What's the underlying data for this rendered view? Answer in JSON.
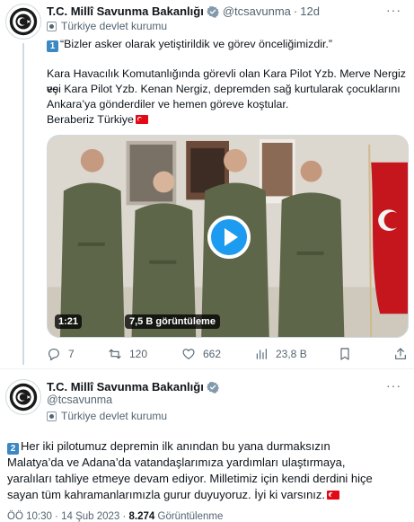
{
  "tweet1": {
    "name": "T.C. Millî Savunma Bakanlığı",
    "handle": "@tcsavunma",
    "time": "12d",
    "org": "Türkiye devlet kurumu",
    "line1": "“Bizler asker olarak yetiştirildik ve görev önceliğimizdir.”",
    "line2": "Kara Havacılık Komutanlığında görevli olan Kara Pilot Yzb. Merve Nergiz ve",
    "line3": "eşi Kara Pilot Yzb. Kenan Nergiz, depremden sağ kurtularak çocuklarını",
    "line4": "Ankara’ya gönderdiler ve hemen göreve koştular.",
    "line5": "Beraberiz Türkiye",
    "number_emoji": "1",
    "video": {
      "duration": "1:21",
      "views": "7,5 B görüntüleme"
    },
    "actions": {
      "replies": "7",
      "retweets": "120",
      "likes": "662",
      "views": "23,8 B"
    }
  },
  "tweet2": {
    "name": "T.C. Millî Savunma Bakanlığı",
    "handle": "@tcsavunma",
    "org": "Türkiye devlet kurumu",
    "number_emoji": "2",
    "line1": "Her iki pilotumuz depremin ilk anından bu yana durmaksızın",
    "line2": "Malatya’da ve Adana’da vatandaşlarımıza yardımları ulaştırmaya,",
    "line3": "yaralıları tahliye etmeye devam ediyor. Milletimiz için kendi derdini hiçe",
    "line4": "sayan tüm kahramanlarımızla gurur duyuyoruz. İyi ki varsınız.",
    "footer_time": "ÖÖ 10:30 · 14 Şub 2023 · ",
    "footer_views": "8.274",
    "footer_views_label": " Görüntülenme"
  },
  "colors": {
    "accent": "#1d9bf0",
    "secondary_text": "#536471",
    "verified_gray": "#829aab",
    "keycap_blue": "#3b88c3",
    "flag_red": "#e30a17"
  },
  "icons": [
    "reply-icon",
    "retweet-icon",
    "like-icon",
    "views-icon",
    "bookmark-icon",
    "share-icon",
    "verified-badge-icon",
    "more-icon",
    "play-icon"
  ]
}
